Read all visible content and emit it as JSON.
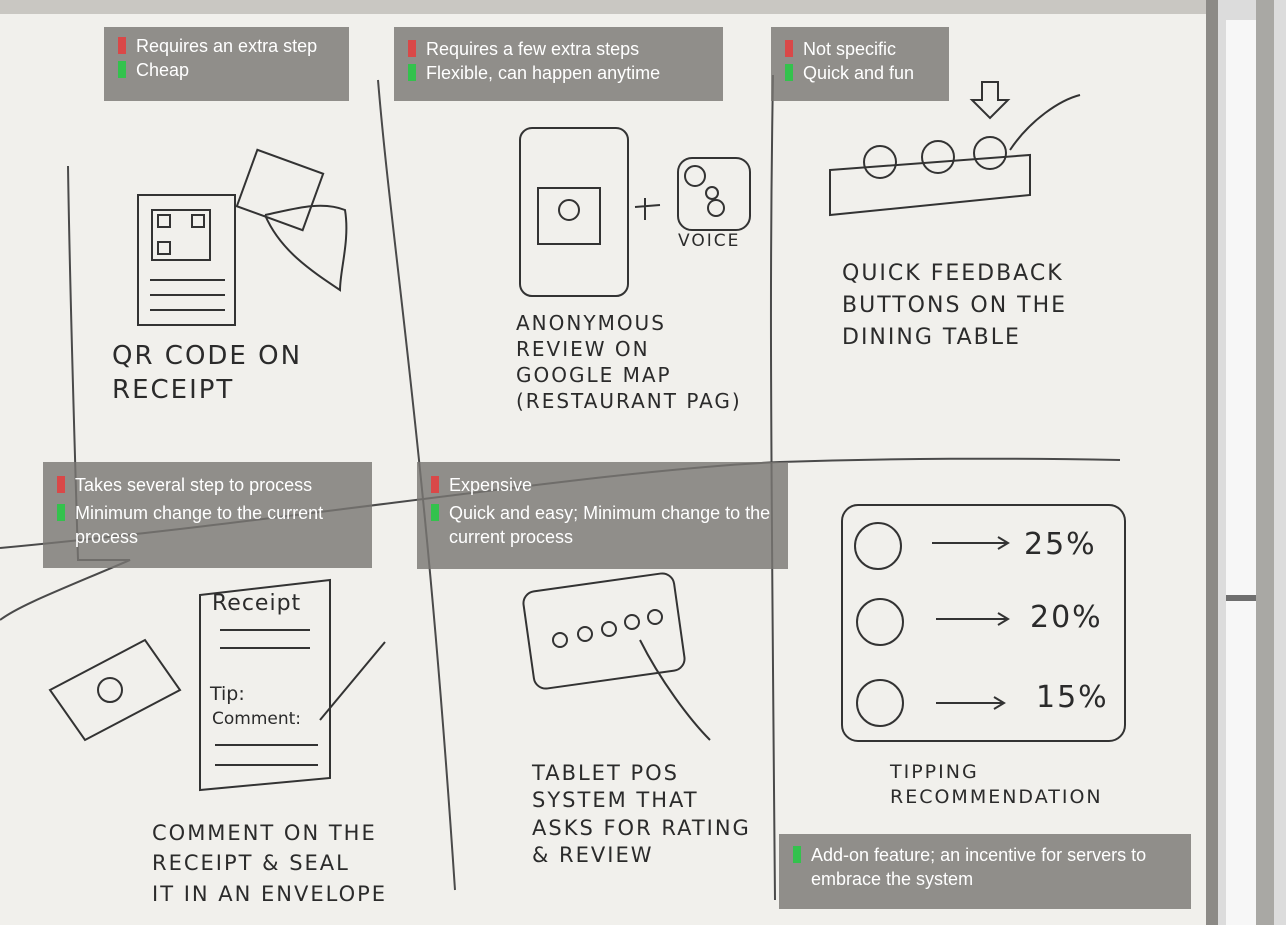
{
  "colors": {
    "con": "#d94848",
    "pro": "#33c24d",
    "note_bg": "#787672",
    "board": "#f2f1ee"
  },
  "sketches": {
    "qr_receipt": "QR CODE ON\nRECEIPT",
    "google_review": "ANONYMOUS\nREVIEW ON\nGOOGLE MAP\n(RESTAURANT PAG)",
    "voice": "VOICE",
    "feedback_buttons": "QUICK FEEDBACK\nBUTTONS ON THE\nDINING TABLE",
    "comment_receipt": "COMMENT ON THE\nRECEIPT & SEAL\nIT IN AN ENVELOPE",
    "receipt_title": "Receipt",
    "receipt_tip": "Tip:",
    "receipt_comment": "Comment:",
    "tablet_pos": "TABLET POS\nSYSTEM THAT\nASKS FOR RATING\n& REVIEW",
    "tipping": "TIPPING\nRECOMMENDATION",
    "tip_25": "25%",
    "tip_20": "20%",
    "tip_15": "15%"
  },
  "notes": {
    "n1": {
      "con": "Requires an extra step",
      "pro": "Cheap"
    },
    "n2": {
      "con": "Requires a few extra steps",
      "pro": "Flexible, can happen anytime"
    },
    "n3": {
      "con": "Not specific",
      "pro": "Quick and fun"
    },
    "n4": {
      "con": "Takes several step to process",
      "pro": "Minimum change to the current process"
    },
    "n5": {
      "con": "Expensive",
      "pro": "Quick and easy; Minimum change to the current process"
    },
    "n6": {
      "pro": "Add-on feature; an incentive for servers to embrace the system"
    }
  }
}
